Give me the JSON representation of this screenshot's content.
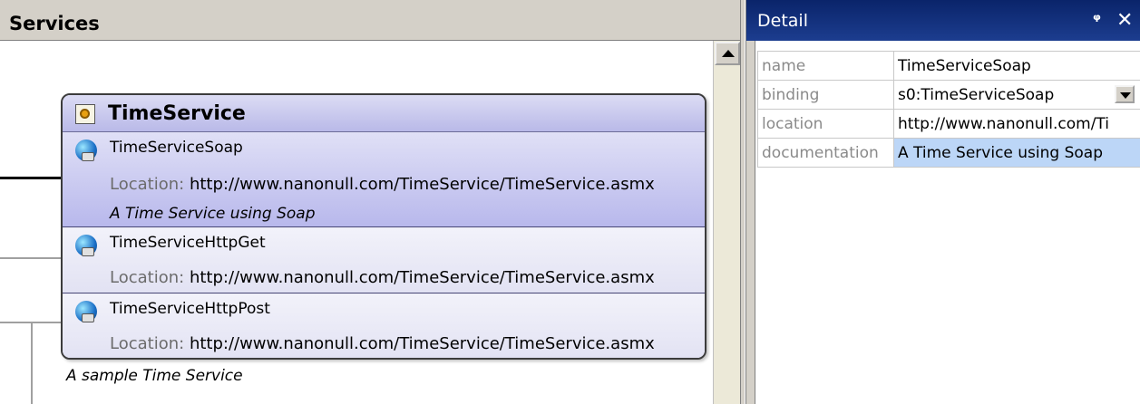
{
  "services": {
    "header_title": "Services",
    "service": {
      "name": "TimeService",
      "ports": [
        {
          "name": "TimeServiceSoap",
          "location_label": "Location:",
          "location": "http://www.nanonull.com/TimeService/TimeService.asmx",
          "documentation": "A Time Service using Soap"
        },
        {
          "name": "TimeServiceHttpGet",
          "location_label": "Location:",
          "location": "http://www.nanonull.com/TimeService/TimeService.asmx"
        },
        {
          "name": "TimeServiceHttpPost",
          "location_label": "Location:",
          "location": "http://www.nanonull.com/TimeService/TimeService.asmx"
        }
      ],
      "documentation": "A sample Time Service"
    },
    "icons": {
      "service": "service-icon",
      "port": "globe-icon"
    }
  },
  "detail": {
    "title": "Detail",
    "pin_symbol": "ᵠ",
    "close_symbol": "✕",
    "rows": [
      {
        "key": "name",
        "value": "TimeServiceSoap"
      },
      {
        "key": "binding",
        "value": "s0:TimeServiceSoap"
      },
      {
        "key": "location",
        "value": "http://www.nanonull.com/Ti"
      },
      {
        "key": "documentation",
        "value": "A Time Service using Soap"
      }
    ]
  },
  "colors": {
    "detail_header": "#0a246a",
    "selected_port": "#b8b8ec",
    "highlight_value": "#bcd6f7"
  }
}
